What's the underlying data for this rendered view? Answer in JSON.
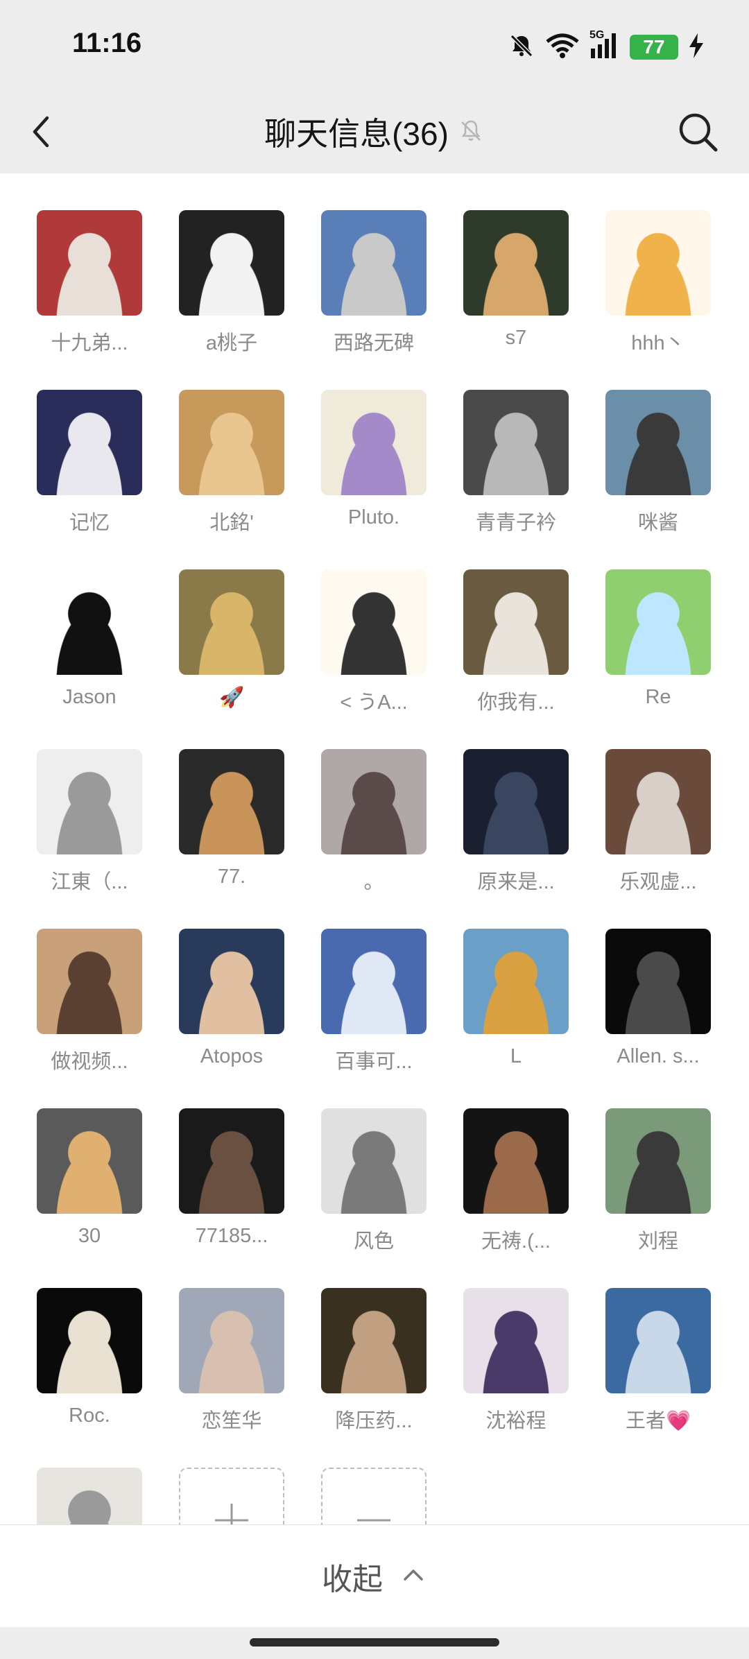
{
  "status_bar": {
    "time": "11:16",
    "network": "5G",
    "battery": "77",
    "icons": [
      "mute-icon",
      "wifi-icon",
      "signal-icon",
      "battery-icon",
      "charging-icon"
    ]
  },
  "header": {
    "title": "聊天信息(36)",
    "back_icon": "chevron-left-icon",
    "mute_icon": "bell-muted-icon",
    "search_icon": "search-icon"
  },
  "members": [
    {
      "name": "十九弟..."
    },
    {
      "name": "a桃子"
    },
    {
      "name": "西路无碑"
    },
    {
      "name": "s7"
    },
    {
      "name": "hhh丶"
    },
    {
      "name": "记忆"
    },
    {
      "name": "北銘'"
    },
    {
      "name": "Pluto."
    },
    {
      "name": "青青子衿"
    },
    {
      "name": "咪酱"
    },
    {
      "name": "Jason"
    },
    {
      "name": "🚀"
    },
    {
      "name": "< うA..."
    },
    {
      "name": "你我有..."
    },
    {
      "name": "Re"
    },
    {
      "name": "江東（..."
    },
    {
      "name": "77."
    },
    {
      "name": "。"
    },
    {
      "name": "原来是..."
    },
    {
      "name": "乐观虚..."
    },
    {
      "name": "做视频..."
    },
    {
      "name": "Atopos"
    },
    {
      "name": "百事可..."
    },
    {
      "name": "L"
    },
    {
      "name": "Allen. s..."
    },
    {
      "name": "30"
    },
    {
      "name": "77185..."
    },
    {
      "name": "风色"
    },
    {
      "name": "无祷.(..."
    },
    {
      "name": "刘程"
    },
    {
      "name": "Roc."
    },
    {
      "name": "恋笙华"
    },
    {
      "name": "降压药..."
    },
    {
      "name": "沈裕程"
    },
    {
      "name": "王者💗"
    },
    {
      "name": ""
    }
  ],
  "actions": {
    "add_icon": "plus-icon",
    "remove_icon": "minus-icon"
  },
  "footer": {
    "collapse_label": "收起",
    "collapse_icon": "chevron-up-icon"
  },
  "colors": {
    "background": "#ededed",
    "content": "#ffffff",
    "text_primary": "#151515",
    "text_secondary": "#8a8a8a",
    "battery": "#35b24a"
  }
}
